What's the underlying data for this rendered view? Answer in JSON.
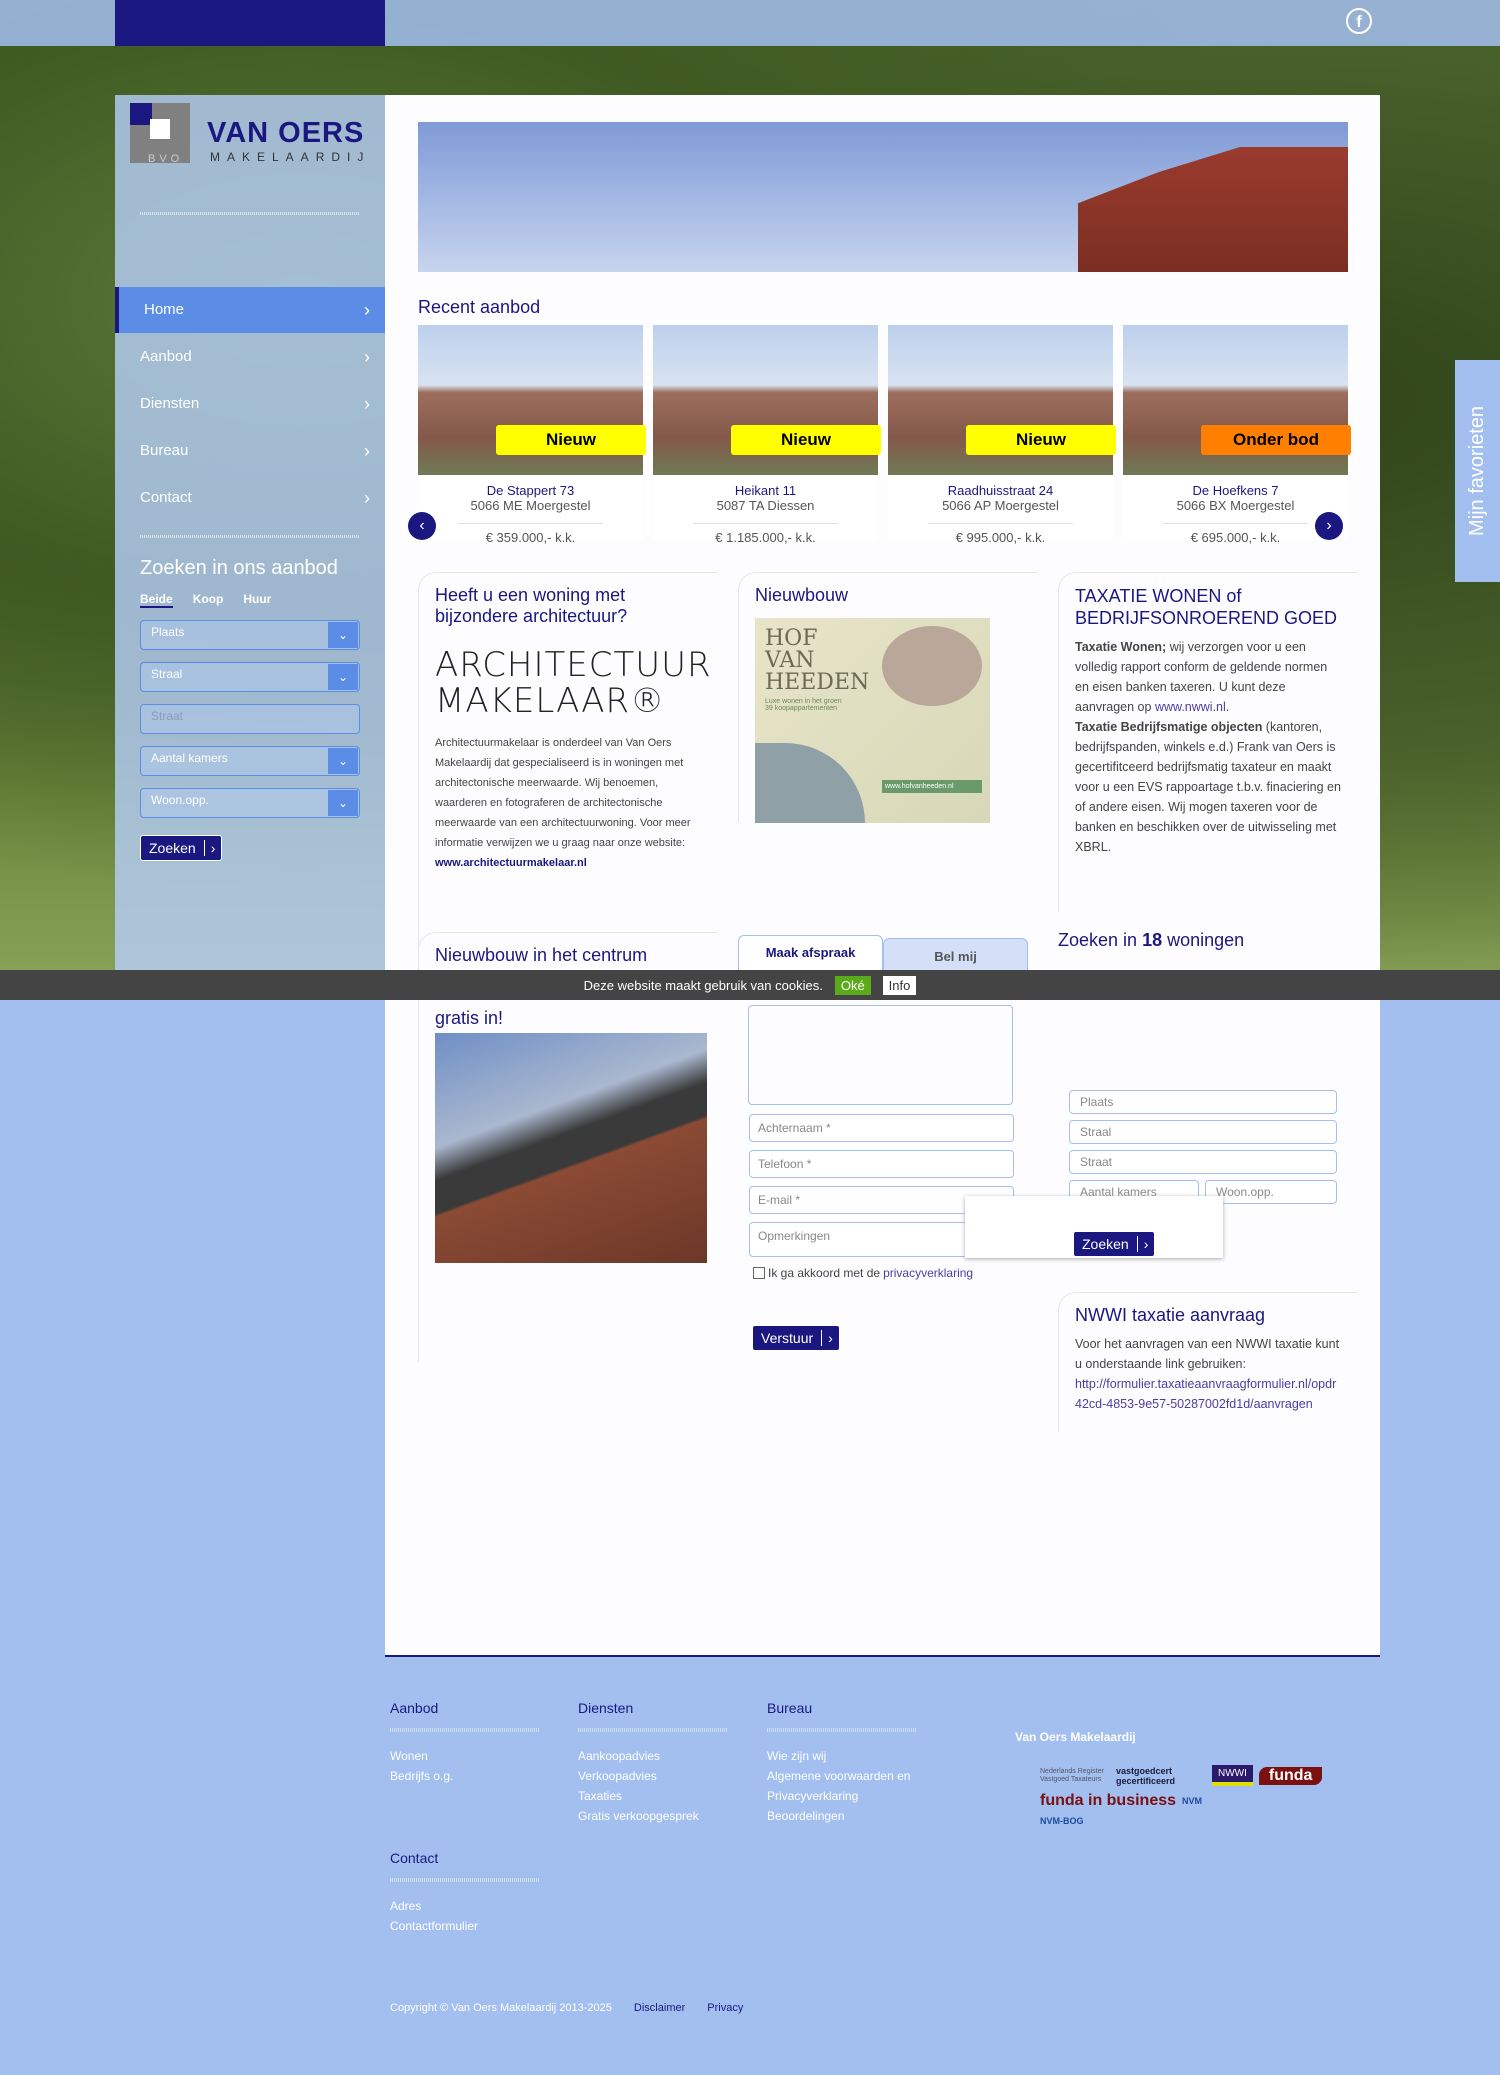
{
  "brand": {
    "name": "VAN OERS",
    "sub": "MAKELAARDIJ",
    "mark": "BVO"
  },
  "top": {
    "facebook_icon": "facebook-icon"
  },
  "sidebar": {
    "nav": [
      {
        "label": "Home"
      },
      {
        "label": "Aanbod"
      },
      {
        "label": "Diensten"
      },
      {
        "label": "Bureau"
      },
      {
        "label": "Contact"
      }
    ],
    "search_title": "Zoeken in ons aanbod",
    "tabs": [
      "Beide",
      "Koop",
      "Huur"
    ],
    "fields": [
      "Plaats",
      "Straal",
      "Straat",
      "Aantal kamers",
      "Woon.opp."
    ],
    "button": "Zoeken"
  },
  "recent": {
    "title": "Recent aanbod",
    "items": [
      {
        "street": "De Stappert 73",
        "place": "5066 ME Moergestel",
        "price": "€ 359.000,- k.k.",
        "badge": "Nieuw"
      },
      {
        "street": "Heikant 11",
        "place": "5087 TA Diessen",
        "price": "€ 1.185.000,- k.k.",
        "badge": "Nieuw"
      },
      {
        "street": "Raadhuisstraat 24",
        "place": "5066 AP Moergestel",
        "price": "€ 995.000,- k.k.",
        "badge": "Nieuw"
      },
      {
        "street": "De Hoefkens 7",
        "place": "5066 BX Moergestel",
        "price": "€ 695.000,- k.k.",
        "badge": "Onder bod"
      }
    ]
  },
  "arch": {
    "title": "Heeft u een woning met bijzondere architectuur?",
    "logo1": "ARCHITECTUUR",
    "logo2": "MAKELAAR®",
    "text": "Architectuurmakelaar is onderdeel van Van Oers Makelaardij dat gespecialiseerd is in woningen met architectonische meerwaarde. Wij benoemen, waarderen en fotograferen de architectonische meerwaarde van een architectuurwoning. Voor meer informatie verwijzen we u graag naar onze website: ",
    "link": "www.architectuurmakelaar.nl"
  },
  "nieuwbouw": {
    "title": "Nieuwbouw",
    "ad_title": "HOF VAN HEEDEN",
    "ad_sub": "Luxe wonen in het groen",
    "ad_sub2": "39 koopappartementen",
    "ad_url": "www.hofvanheeden.nl"
  },
  "taxatie": {
    "title": "TAXATIE WONEN of BEDRIJFSONROEREND GOED",
    "b1": "Taxatie Wonen;",
    "t1": " wij verzorgen voor u een volledig rapport conform de geldende normen en eisen banken taxeren. U kunt deze aanvragen op ",
    "link": "www.nwwi.nl",
    "t1b": ".",
    "b2": "Taxatie Bedrijfsmatige objecten",
    "t2": " (kantoren, bedrijfspanden, winkels e.d.) Frank van Oers is gecertifitceerd bedrijfsmatig taxateur en maakt voor u een EVS rappoartage t.b.v. finaciering en of andere eisen. Wij mogen taxeren voor de banken en beschikken over de uitwisseling met XBRL."
  },
  "centrum": {
    "title": "Nieuwbouw in het centrum",
    "sub": "gratis in!"
  },
  "form": {
    "tabs": [
      "Maak afspraak",
      "Bel mij"
    ],
    "placeholders": [
      "Achternaam *",
      "Telefoon *",
      "E-mail *",
      "Opmerkingen"
    ],
    "consent": "Ik ga akkoord met de ",
    "consent_link": "privacyverklaring",
    "submit": "Verstuur"
  },
  "search2": {
    "title_pre": "Zoeken in ",
    "count": "18",
    "title_post": " woningen",
    "fields": [
      "Plaats",
      "Straal",
      "Straat",
      "Aantal kamers",
      "Woon.opp."
    ],
    "button": "Zoeken"
  },
  "nwwi": {
    "title": "NWWI taxatie aanvraag",
    "text": "Voor het aanvragen van een NWWI taxatie kunt u onderstaande link gebruiken:",
    "link": "http://formulier.taxatieaanvraagformulier.nl/opdr 42cd-4853-9e57-50287002fd1d/aanvragen"
  },
  "cookie": {
    "text": "Deze website maakt gebruik van cookies.",
    "ok": "Oké",
    "info": "Info"
  },
  "favorites": "Mijn favorieten",
  "footer": {
    "cols": [
      {
        "title": "Aanbod",
        "links": [
          "Wonen",
          "Bedrijfs o.g."
        ]
      },
      {
        "title": "Diensten",
        "links": [
          "Aankoopadvies",
          "Verkoopadvies",
          "Taxaties",
          "Gratis verkoopgesprek"
        ]
      },
      {
        "title": "Bureau",
        "links": [
          "Wie zijn wij",
          "Algemene voorwaarden en",
          "Privacyverklaring",
          "Beoordelingen"
        ]
      },
      {
        "title": "Contact",
        "links": [
          "Adres",
          "Contactformulier"
        ]
      }
    ],
    "company": "Van Oers Makelaardij",
    "logos": [
      "Nederlands Register Vastgoed Taxateurs",
      "vastgoedcert gecertificeerd",
      "NWWI",
      "funda",
      "funda in business",
      "NVM",
      "NVM-BOG"
    ],
    "copyright": "Copyright © Van Oers Makelaardij 2013-2025",
    "disclaimer": "Disclaimer",
    "privacy": "Privacy"
  }
}
